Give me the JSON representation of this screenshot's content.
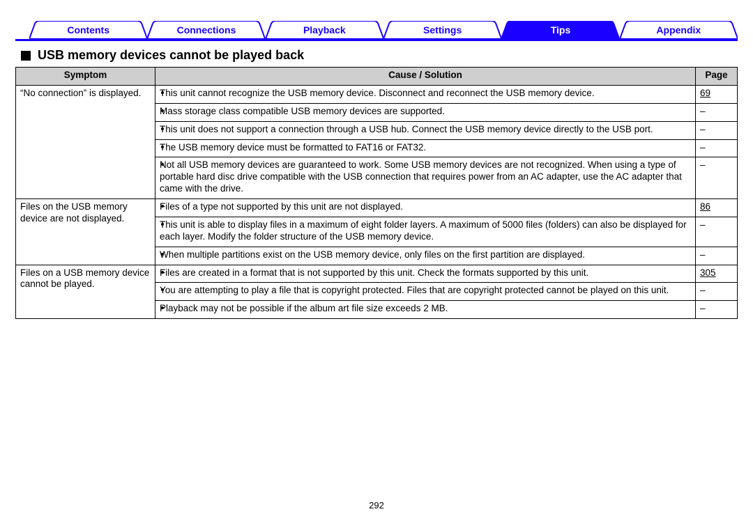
{
  "tabs": {
    "items": [
      {
        "label": "Contents",
        "active": false
      },
      {
        "label": "Connections",
        "active": false
      },
      {
        "label": "Playback",
        "active": false
      },
      {
        "label": "Settings",
        "active": false
      },
      {
        "label": "Tips",
        "active": true
      },
      {
        "label": "Appendix",
        "active": false
      }
    ]
  },
  "heading": "USB memory devices cannot be played back",
  "table": {
    "headers": {
      "symptom": "Symptom",
      "cause": "Cause / Solution",
      "page": "Page"
    },
    "groups": [
      {
        "symptom": "“No connection” is displayed.",
        "rows": [
          {
            "cause": "This unit cannot recognize the USB memory device. Disconnect and reconnect the USB memory device.",
            "page": "69",
            "link": true
          },
          {
            "cause": "Mass storage class compatible USB memory devices are supported.",
            "page": "–",
            "link": false
          },
          {
            "cause": "This unit does not support a connection through a USB hub. Connect the USB memory device directly to the USB port.",
            "page": "–",
            "link": false
          },
          {
            "cause": "The USB memory device must be formatted to FAT16 or FAT32.",
            "page": "–",
            "link": false
          },
          {
            "cause": "Not all USB memory devices are guaranteed to work. Some USB memory devices are not recognized. When using a type of portable hard disc drive compatible with the USB connection that requires power from an AC adapter, use the AC adapter that came with the drive.",
            "page": "–",
            "link": false
          }
        ]
      },
      {
        "symptom": "Files on the USB memory device are not displayed.",
        "rows": [
          {
            "cause": "Files of a type not supported by this unit are not displayed.",
            "page": "86",
            "link": true
          },
          {
            "cause": "This unit is able to display files in a maximum of eight folder layers. A maximum of 5000 files (folders) can also be displayed for each layer. Modify the folder structure of the USB memory device.",
            "page": "–",
            "link": false
          },
          {
            "cause": "When multiple partitions exist on the USB memory device, only files on the first partition are displayed.",
            "page": "–",
            "link": false
          }
        ]
      },
      {
        "symptom": "Files on a USB memory device cannot be played.",
        "rows": [
          {
            "cause": "Files are created in a format that is not supported by this unit. Check the formats supported by this unit.",
            "page": "305",
            "link": true
          },
          {
            "cause": "You are attempting to play a file that is copyright protected. Files that are copyright protected cannot be played on this unit.",
            "page": "–",
            "link": false
          },
          {
            "cause": "Playback may not be possible if the album art file size exceeds 2 MB.",
            "page": "–",
            "link": false
          }
        ]
      }
    ]
  },
  "page_number": "292",
  "colors": {
    "brand_blue": "#1a00ff",
    "tab_fill_active": "#1a00ff",
    "header_grey": "#cfcfcf"
  }
}
